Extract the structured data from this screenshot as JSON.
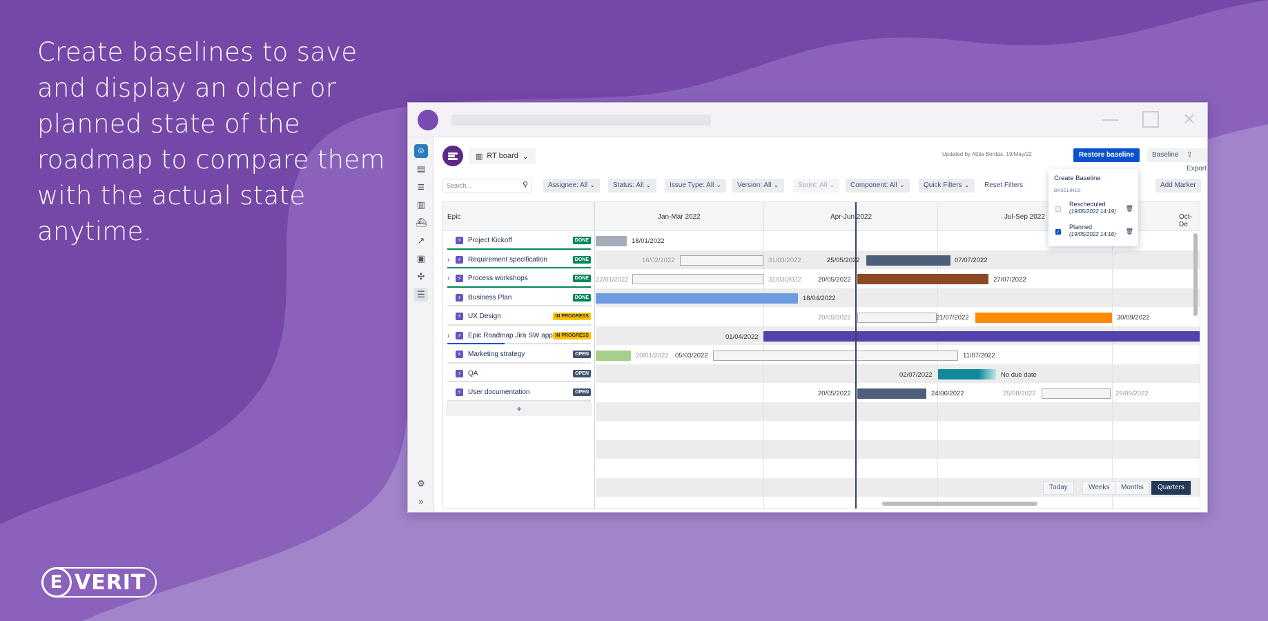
{
  "headline": "Create baselines to save and display an older or planned state of the roadmap to compare them with the actual state anytime.",
  "logo_text": "VERIT",
  "logo_mark": "E",
  "colors": {
    "background": "#7548a8",
    "primary_button": "#0a52cc",
    "done": "#00875a",
    "in_progress": "#ffc400",
    "open": "#42526e"
  },
  "topbar": {
    "board_label": "RT board",
    "updated_text": "Updated by Attila Bordás, 19/May/22",
    "restore_label": "Restore baseline",
    "baseline_label": "Baseline",
    "export_label": "Export"
  },
  "filters": {
    "search_placeholder": "Search...",
    "assignee": "Assignee: All",
    "status": "Status: All",
    "issue_type": "Issue Type: All",
    "version": "Version: All",
    "sprint": "Sprint: All",
    "component": "Component: All",
    "quick_filters": "Quick Filters",
    "reset": "Reset Filters",
    "add_marker": "Add Marker"
  },
  "grid": {
    "epic_header": "Epic",
    "add_label": "+",
    "quarters": [
      "Jan-Mar 2022",
      "Apr-Jun 2022",
      "Jul-Sep 2022",
      "Oct-De"
    ],
    "epics": [
      {
        "name": "Project Kickoff",
        "status": "DONE",
        "expandable": false,
        "progress": 1.0
      },
      {
        "name": "Requirement specification",
        "status": "DONE",
        "expandable": true,
        "progress": 1.0
      },
      {
        "name": "Process workshops",
        "status": "DONE",
        "expandable": true,
        "progress": 1.0
      },
      {
        "name": "Business Plan",
        "status": "DONE",
        "expandable": false,
        "progress": 0
      },
      {
        "name": "UX Design",
        "status": "IN PROGRESS",
        "expandable": false,
        "progress": 0
      },
      {
        "name": "Epic Roadmap Jira SW app",
        "status": "IN PROGRESS",
        "expandable": true,
        "progress": 0.4
      },
      {
        "name": "Marketing strategy",
        "status": "OPEN",
        "expandable": false,
        "progress": 0
      },
      {
        "name": "QA",
        "status": "OPEN",
        "expandable": false,
        "progress": 0
      },
      {
        "name": "User documentation",
        "status": "OPEN",
        "expandable": false,
        "progress": 0
      }
    ],
    "dates": {
      "r0_end": "18/01/2022",
      "r1_bl_start": "16/02/2022",
      "r1_bl_end": "31/03/2022",
      "r1_start": "25/05/2022",
      "r1_end": "07/07/2022",
      "r2_bl_start": "22/01/2022",
      "r2_bl_end": "31/03/2022",
      "r2_start": "20/05/2022",
      "r2_end": "27/07/2022",
      "r3_end": "18/04/2022",
      "r4_bl_start": "20/05/2022",
      "r4_start": "21/07/2022",
      "r4_end": "30/09/2022",
      "r5_start": "01/04/2022",
      "r6_bl_end": "20/01/2022",
      "r6_start": "05/03/2022",
      "r6_end": "11/07/2022",
      "r7_start": "02/07/2022",
      "r7_end": "No due date",
      "r8_start": "20/05/2022",
      "r8_end": "24/06/2022",
      "r8_bl_start": "25/08/2022",
      "r8_bl_end": "29/09/2022"
    }
  },
  "zoom": {
    "today": "Today",
    "weeks": "Weeks",
    "months": "Months",
    "quarters": "Quarters"
  },
  "baseline_menu": {
    "create": "Create Baseline",
    "heading": "BASELINES",
    "items": [
      {
        "name": "Rescheduled",
        "date": "(19/05/2022 14:19)",
        "checked": false
      },
      {
        "name": "Planned",
        "date": "(19/05/2022 14:16)",
        "checked": true
      }
    ]
  }
}
